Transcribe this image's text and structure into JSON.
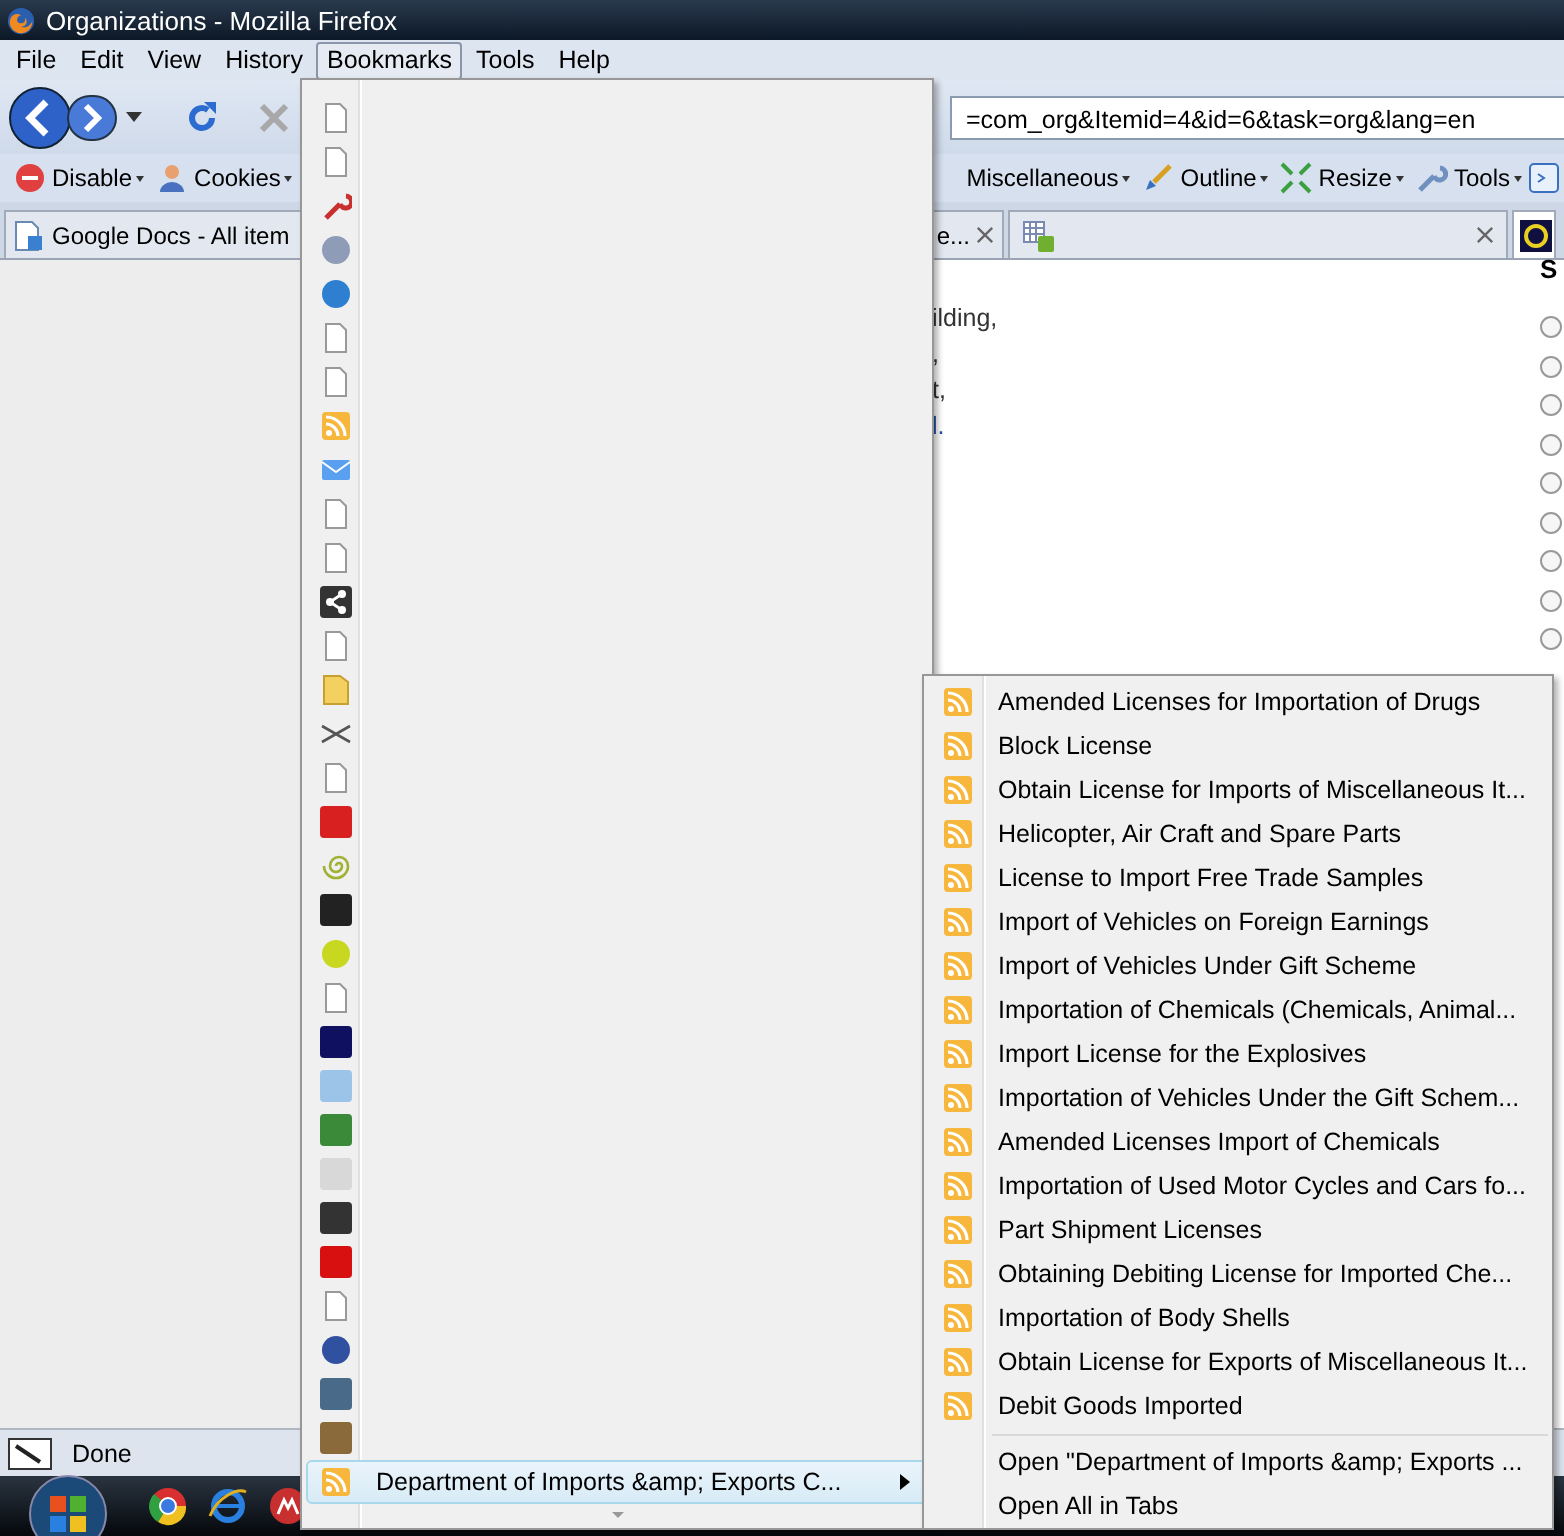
{
  "window": {
    "title": "Organizations - Mozilla Firefox"
  },
  "menu_bar": [
    {
      "label": "File",
      "selected": false
    },
    {
      "label": "Edit",
      "selected": false
    },
    {
      "label": "View",
      "selected": false
    },
    {
      "label": "History",
      "selected": false
    },
    {
      "label": "Bookmarks",
      "selected": true
    },
    {
      "label": "Tools",
      "selected": false
    },
    {
      "label": "Help",
      "selected": false
    }
  ],
  "address_bar": {
    "value": "=com_org&Itemid=4&id=6&task=org&lang=en"
  },
  "toolbar_left": [
    {
      "label": "Disable",
      "kind": "disable"
    },
    {
      "label": "Cookies",
      "kind": "cookies"
    }
  ],
  "toolbar_right": [
    {
      "label": "Miscellaneous",
      "kind": "misc"
    },
    {
      "label": "Outline",
      "kind": "outline"
    },
    {
      "label": "Resize",
      "kind": "resize"
    },
    {
      "label": "Tools",
      "kind": "tools"
    }
  ],
  "tabs": [
    {
      "label": "Google Docs - All item",
      "kind": "docs",
      "selected": false
    },
    {
      "label": "e...",
      "kind": "plain",
      "selected": false
    },
    {
      "kind": "sheet",
      "selected": false
    },
    {
      "kind": "mini",
      "selected": true
    }
  ],
  "page": {
    "text_lines": [
      "ilding,",
      ",",
      "t,",
      "l."
    ],
    "sidebar_heading": "S",
    "radios": [
      {
        "selected": false
      },
      {
        "selected": false
      },
      {
        "selected": false
      },
      {
        "selected": false
      },
      {
        "selected": false
      },
      {
        "selected": false
      },
      {
        "selected": false
      },
      {
        "selected": false
      },
      {
        "selected": false
      }
    ]
  },
  "bookmarks_menu": {
    "items": [
      {
        "kind": "page"
      },
      {
        "kind": "page"
      },
      {
        "kind": "wrench"
      },
      {
        "kind": "orb",
        "color": "#8e9cb8"
      },
      {
        "kind": "orb",
        "color": "#2f7fd0"
      },
      {
        "kind": "page"
      },
      {
        "kind": "page"
      },
      {
        "kind": "feed"
      },
      {
        "kind": "mail"
      },
      {
        "kind": "page"
      },
      {
        "kind": "page"
      },
      {
        "kind": "share"
      },
      {
        "kind": "page"
      },
      {
        "kind": "folder"
      },
      {
        "kind": "scissors"
      },
      {
        "kind": "page"
      },
      {
        "kind": "tile",
        "color": "#d92020"
      },
      {
        "kind": "spiral"
      },
      {
        "kind": "tile",
        "color": "#222222"
      },
      {
        "kind": "orb",
        "color": "#c8d820"
      },
      {
        "kind": "page"
      },
      {
        "kind": "tile",
        "color": "#101060"
      },
      {
        "kind": "tile",
        "color": "#9cc4e8"
      },
      {
        "kind": "tile",
        "color": "#3a8a3a"
      },
      {
        "kind": "tile",
        "color": "#d8d8d8"
      },
      {
        "kind": "tile",
        "color": "#333333"
      },
      {
        "kind": "tile",
        "color": "#d81010"
      },
      {
        "kind": "page"
      },
      {
        "kind": "orb",
        "color": "#3050a0"
      },
      {
        "kind": "tile",
        "color": "#4a6a8a"
      },
      {
        "kind": "tile",
        "color": "#8a6a3a"
      },
      {
        "kind": "feed",
        "label": "Department of Imports &amp; Exports C...",
        "selected": true
      }
    ]
  },
  "submenu": {
    "feeds": [
      "Amended Licenses for Importation of Drugs",
      "Block License",
      "Obtain License for Imports of Miscellaneous It...",
      "Helicopter, Air Craft and Spare Parts",
      "License to Import Free Trade Samples",
      "Import of Vehicles on Foreign Earnings",
      "Import of Vehicles Under Gift Scheme",
      "Importation of Chemicals (Chemicals, Animal...",
      "Import License for the Explosives",
      "Importation of Vehicles Under the Gift Schem...",
      "Amended Licenses Import of Chemicals",
      "Importation of Used Motor Cycles and Cars fo...",
      "Part Shipment Licenses",
      "Obtaining Debiting License for Imported Che...",
      "Importation of Body Shells",
      "Obtain License for Exports of Miscellaneous It...",
      "Debit Goods Imported"
    ],
    "actions": [
      "Open \"Department of Imports &amp; Exports ...",
      "Open All in Tabs"
    ]
  },
  "status_bar": {
    "text": "Done"
  }
}
